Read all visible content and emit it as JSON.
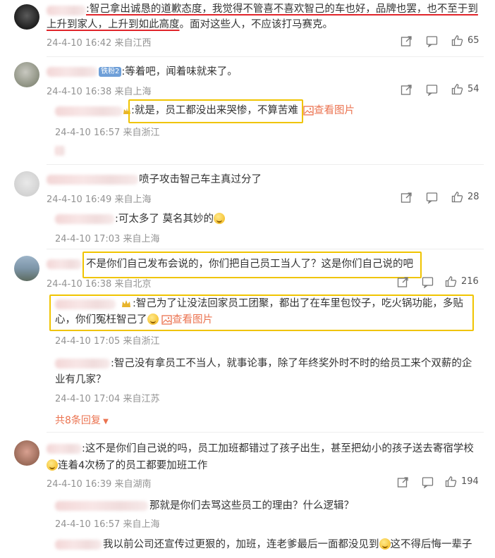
{
  "colors": {
    "link": "#eb7350",
    "meta": "#939393",
    "highlight": "#f0c400",
    "underline": "#e0242a"
  },
  "comments": [
    {
      "text_part1": ":智己拿出诚恳的道歉态度，我觉得不管喜不喜欢智己的车也好，品牌也罢，也不至于到",
      "text_part2a": "上升到家人，上升到如此高度",
      "text_part2b": "。面对这些人，不应该打马赛克。",
      "meta": "24-4-10 16:42 来自江西",
      "likes": "65"
    },
    {
      "badge": "铁粉2",
      "text": ":等着吧，闻着味就来了。",
      "meta": "24-4-10 16:38 来自上海",
      "likes": "54",
      "reply": {
        "text": ":就是，员工都没出来哭惨，不算苦难",
        "view_image": "查看图片",
        "meta": "24-4-10 16:57 来自浙江"
      }
    },
    {
      "text": "喷子攻击智己车主真过分了",
      "meta": "24-4-10 16:49 来自上海",
      "likes": "28",
      "reply": {
        "text": ":可太多了 莫名其妙的",
        "meta": "24-4-10 17:03 来自上海"
      }
    },
    {
      "text": "不是你们自己发布会说的，你们把自己员工当人了？这是你们自己说的吧",
      "meta": "24-4-10 16:38 来自北京",
      "likes": "216",
      "reply1": {
        "line1": ":智己为了让没法回家员工团聚，都出了在车里包饺子，吃火锅功能，多贴",
        "line2": "心，你们冤枉智己了",
        "view_image": "查看图片",
        "meta": "24-4-10 17:05 来自浙江"
      },
      "reply2": {
        "line1": ":智己没有拿员工不当人，就事论事，除了年终奖外时不时的给员工来个双薪的企",
        "line2": "业有几家？",
        "meta": "24-4-10 17:04 来自江苏"
      },
      "more_replies": "共8条回复"
    },
    {
      "line1": ":这不是你们自己说的吗，员工加班都错过了孩子出生，甚至把幼小的孩子送去寄宿学校",
      "line2": "连着4次杨了的员工都要加班工作",
      "meta": "24-4-10 16:39 来自湖南",
      "likes": "194",
      "reply1": {
        "text": "那就是你们去骂这些员工的理由？什么逻辑？",
        "meta": "24-4-10 16:57 来自上海"
      },
      "reply2": {
        "text_a": "我以前公司还宣传过更狠的，加班，连老爹最后一面都没见到",
        "text_b": "这不得后悔一辈子"
      }
    }
  ]
}
